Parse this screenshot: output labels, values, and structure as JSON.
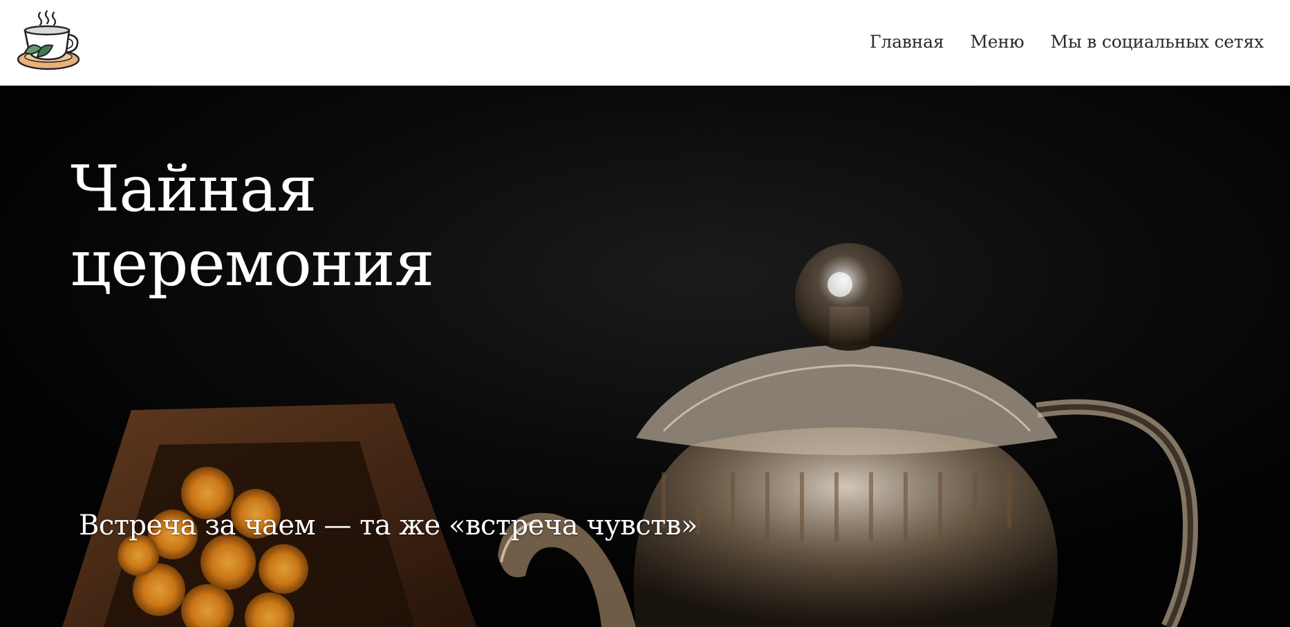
{
  "header": {
    "logo_icon": "tea-cup-logo-icon",
    "nav": [
      {
        "label": "Главная"
      },
      {
        "label": "Меню"
      },
      {
        "label": "Мы в социальных сетях"
      }
    ]
  },
  "hero": {
    "title_line1": "Чайная",
    "title_line2": "церемония",
    "subtitle": "Встреча за чаем — та же «встреча чувств»",
    "background_icon": "glass-teapot-photo"
  },
  "colors": {
    "header_bg": "#ffffff",
    "nav_text": "#2a2a2a",
    "hero_bg": "#050505",
    "hero_text": "#ffffff"
  }
}
